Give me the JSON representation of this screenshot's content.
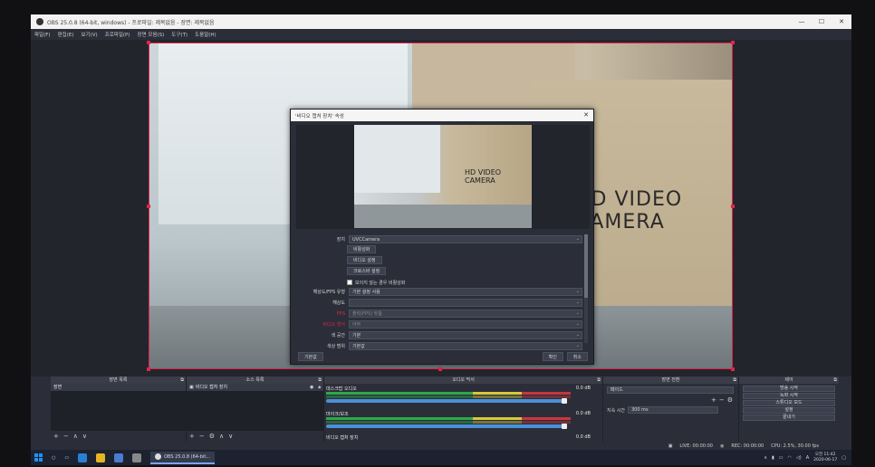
{
  "window": {
    "title": "OBS 25.0.8 (64-bit, windows) - 프로파일: 제목없음 - 장면: 제목없음",
    "min": "—",
    "max": "☐",
    "close": "✕"
  },
  "menu": [
    "파일(F)",
    "편집(E)",
    "보기(V)",
    "프로파일(P)",
    "장면 모음(S)",
    "도구(T)",
    "도움말(H)"
  ],
  "preview": {
    "box_text": "HD VIDEO CAMERA"
  },
  "dialog": {
    "title": "'비디오 캡처 장치' 속성",
    "close": "✕",
    "cam_text": "HD VIDEO CAMERA",
    "device_label": "장치",
    "device_value": "UVCCamera",
    "buttons": [
      "비활성화",
      "비디오 설정",
      "크로스바 설정"
    ],
    "deactivate_checkbox": "보이지 않는 경우 비활성화",
    "rows": [
      {
        "label": "해상도/FPS 유형",
        "value": "기본 설정 사용",
        "red": false,
        "dim": false
      },
      {
        "label": "해상도",
        "value": "",
        "red": false,
        "dim": false
      },
      {
        "label": "FPS",
        "value": "출력(FPS) 맞춤",
        "red": true,
        "dim": true
      },
      {
        "label": "비디오 형식",
        "value": "아무",
        "red": true,
        "dim": true
      },
      {
        "label": "색 공간",
        "value": "기본",
        "red": false,
        "dim": false
      },
      {
        "label": "색상 범위",
        "value": "기본값",
        "red": false,
        "dim": false
      }
    ],
    "defaults_button": "기본값",
    "ok_button": "확인",
    "cancel_button": "취소"
  },
  "docks": {
    "scenes": {
      "title": "장면 목록",
      "items": [
        "장면"
      ]
    },
    "sources": {
      "title": "소스 목록",
      "items": [
        "비디오 캡처 장치"
      ]
    },
    "mixer": {
      "title": "오디오 믹서",
      "channels": [
        {
          "name": "데스크탑 오디오",
          "db": "0.0 dB"
        },
        {
          "name": "마이크/보조",
          "db": "0.0 dB"
        },
        {
          "name": "비디오 캡처 장치",
          "db": "0.0 dB"
        }
      ]
    },
    "transitions": {
      "title": "장면 전환",
      "type": "페이드",
      "duration_label": "지속 시간",
      "duration_value": "300 ms"
    },
    "controls": {
      "title": "제어",
      "buttons": [
        "방송 시작",
        "녹화 시작",
        "스튜디오 모드",
        "설정",
        "끝내기"
      ]
    }
  },
  "status": {
    "live": "LIVE: 00:00:00",
    "rec": "REC: 00:00:00",
    "cpu": "CPU: 2.5%, 30.00 fps"
  },
  "taskbar": {
    "app_label": "OBS 25.0.8 (64-bit...",
    "time": "오전 11:42",
    "date": "2020-06-17"
  },
  "colors": {
    "accent_red": "#e0254a",
    "obs_bg": "#2b2e38",
    "panel_dark": "#1f2128"
  }
}
